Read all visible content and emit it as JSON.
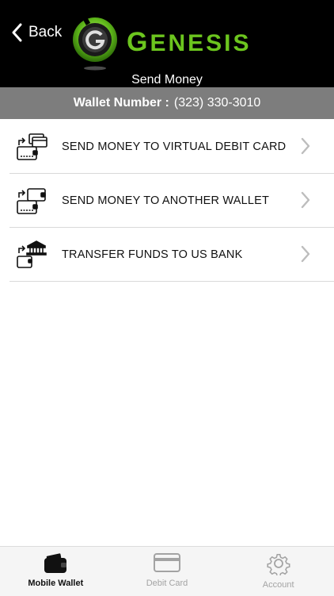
{
  "header": {
    "back_label": "Back",
    "brand_initial": "G",
    "brand_rest": "ENESIS",
    "title": "Send Money"
  },
  "wallet": {
    "label": "Wallet Number :",
    "number": "(323) 330-3010"
  },
  "menu": [
    {
      "label": "SEND MONEY TO VIRTUAL DEBIT CARD",
      "icon": "wallet-to-card-icon"
    },
    {
      "label": "SEND MONEY TO ANOTHER WALLET",
      "icon": "wallet-to-wallet-icon"
    },
    {
      "label": "TRANSFER FUNDS TO US BANK",
      "icon": "wallet-to-bank-icon"
    }
  ],
  "tabs": [
    {
      "label": "Mobile Wallet",
      "icon": "wallet-icon",
      "active": true
    },
    {
      "label": "Debit Card",
      "icon": "credit-card-icon",
      "active": false
    },
    {
      "label": "Account",
      "icon": "gear-icon",
      "active": false
    }
  ],
  "colors": {
    "header_bg": "#000000",
    "brand_green": "#6cc51e",
    "wallet_bar_bg": "#7d7d7d",
    "divider": "#d9d9d9",
    "tab_active": "#111111",
    "tab_inactive": "#a3a3a3"
  }
}
